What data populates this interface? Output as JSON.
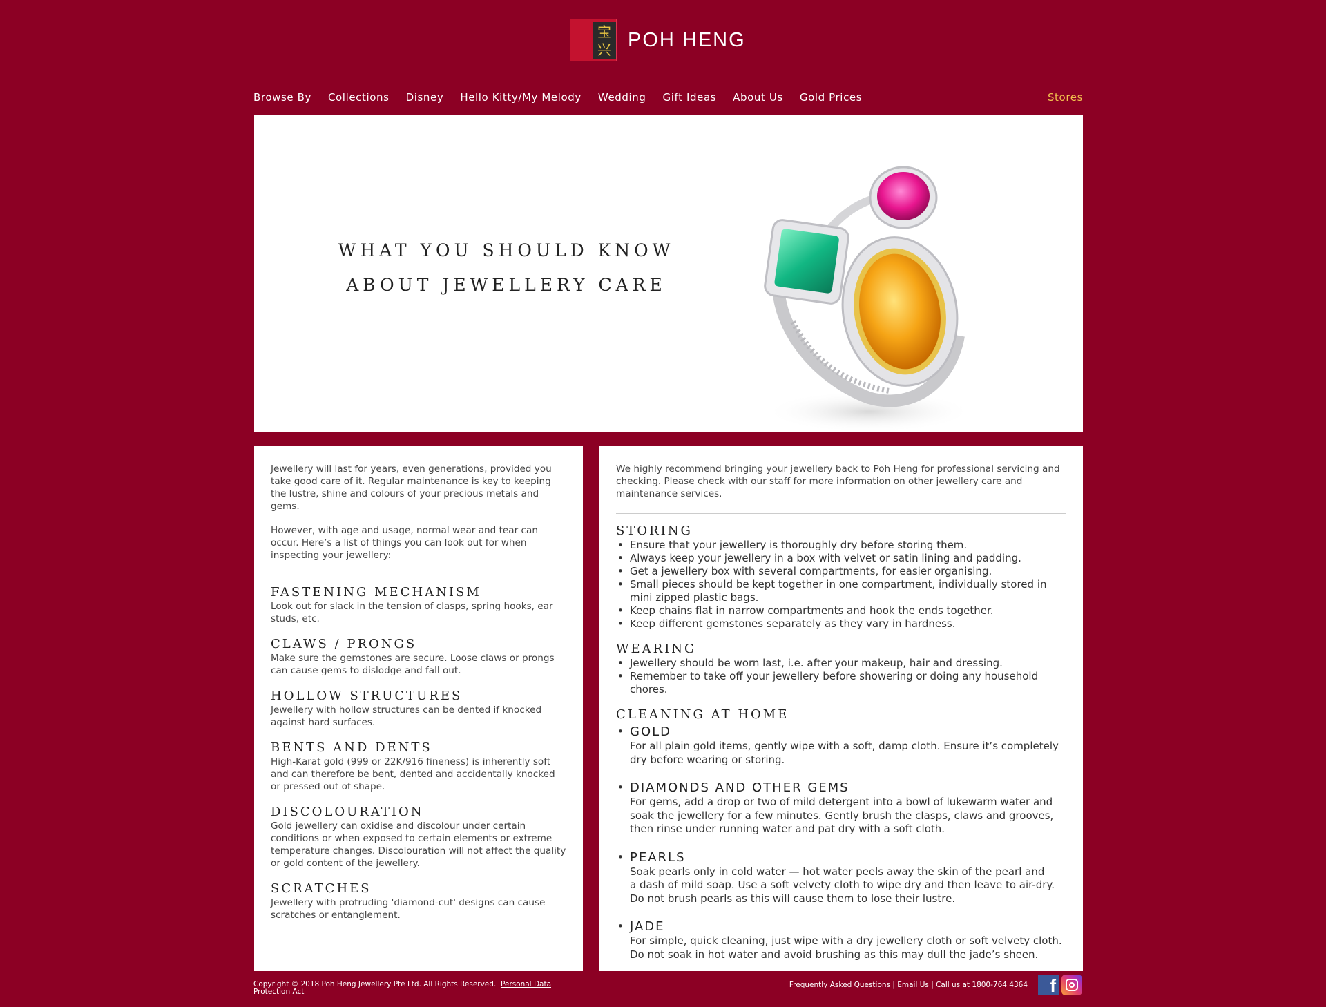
{
  "header": {
    "logo_glyph_top": "宝",
    "logo_glyph_bottom": "兴",
    "brand": "POH HENG"
  },
  "nav": {
    "items": [
      {
        "label": "Browse By"
      },
      {
        "label": "Collections"
      },
      {
        "label": "Disney"
      },
      {
        "label": "Hello Kitty/My Melody"
      },
      {
        "label": "Wedding"
      },
      {
        "label": "Gift Ideas"
      },
      {
        "label": "About Us"
      },
      {
        "label": "Gold Prices"
      }
    ],
    "stores": "Stores",
    "stores_color": "#f2c14e"
  },
  "hero": {
    "title_line1": "WHAT YOU SHOULD KNOW",
    "title_line2": "ABOUT JEWELLERY CARE"
  },
  "left": {
    "intro_p1": "Jewellery will last for years, even generations, provided you take good care of it. Regular maintenance is key to keeping the lustre, shine and colours of your precious metals and gems.",
    "intro_p2": "However, with age and usage, normal wear and tear can occur. Here’s a list of things you can look out for when inspecting your jewellery:",
    "items": [
      {
        "title": "FASTENING MECHANISM",
        "text": "Look out for slack in the tension of clasps, spring hooks, ear studs, etc."
      },
      {
        "title": "CLAWS / PRONGS",
        "text": "Make sure the gemstones are secure. Loose claws or prongs can cause gems to dislodge and fall out."
      },
      {
        "title": "HOLLOW STRUCTURES",
        "text": "Jewellery with hollow structures can be dented if knocked against hard surfaces."
      },
      {
        "title": "BENTS AND DENTS",
        "text": "High-Karat gold (999 or 22K/916 fineness) is inherently soft and can therefore be bent, dented and accidentally knocked or pressed out of shape."
      },
      {
        "title": "DISCOLOURATION",
        "text": "Gold jewellery can oxidise and discolour under certain conditions or when exposed to certain elements or extreme temperature changes. Discolouration will not affect the quality or gold content of the jewellery."
      },
      {
        "title": "SCRATCHES",
        "text": "Jewellery with protruding 'diamond-cut' designs can cause scratches or entanglement."
      }
    ]
  },
  "right": {
    "intro": "We highly recommend bringing your jewellery back to Poh Heng for professional servicing and checking. Please check with our staff for more information on other jewellery care and maintenance services.",
    "storing_title": "STORING",
    "storing": [
      "Ensure that your jewellery is thoroughly dry before storing them.",
      "Always keep your jewellery in a box with velvet or satin lining and padding.",
      "Get a jewellery box with several compartments, for easier organising.",
      "Small pieces should be kept together in one compartment, individually stored in mini zipped plastic bags.",
      "Keep chains flat in narrow compartments and hook the ends together.",
      "Keep different gemstones separately as they vary in hardness."
    ],
    "wearing_title": "WEARING",
    "wearing": [
      "Jewellery should be worn last, i.e. after your makeup, hair and dressing.",
      "Remember to take off your jewellery before showering or doing any household chores."
    ],
    "cleaning_title": "CLEANING AT HOME",
    "cleaning": [
      {
        "title": "GOLD",
        "text": "For all plain gold items, gently wipe with a soft, damp cloth. Ensure it’s completely dry before wearing or storing."
      },
      {
        "title": "DIAMONDS AND OTHER GEMS",
        "text": "For gems, add a drop or two of mild detergent into a bowl of lukewarm water and soak the jewellery for a few minutes. Gently brush the clasps, claws and grooves, then rinse under running water and pat dry with a soft cloth."
      },
      {
        "title": "PEARLS",
        "text": "Soak pearls only in cold water — hot water peels away the skin of the pearl and\na dash of mild soap. Use a soft velvety cloth to wipe dry and then leave to air-dry.\nDo not brush pearls as this will cause them to lose their lustre."
      },
      {
        "title": "JADE",
        "text": "For simple, quick cleaning, just wipe with a dry jewellery cloth or soft velvety cloth.\nDo not soak in hot water and avoid brushing as this may dull the jade’s sheen."
      }
    ]
  },
  "footer": {
    "copyright": "Copyright © 2018 Poh Heng Jewellery Pte Ltd. All Rights Reserved.",
    "pdpa": "Personal Data Protection Act",
    "faq": "Frequently Asked Questions",
    "sep": "|",
    "email": "Email Us",
    "call": "| Call us at 1800-764 4364",
    "facebook_glyph": "f"
  },
  "colors": {
    "background": "#8c0024",
    "logo_red": "#c4122f",
    "logo_gold": "#e8c442"
  },
  "icons": [
    "facebook-icon",
    "instagram-icon"
  ]
}
